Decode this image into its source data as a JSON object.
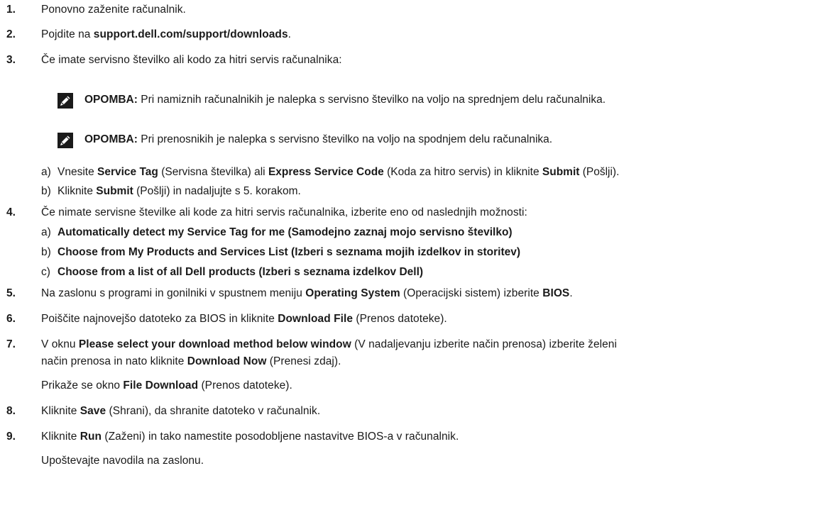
{
  "steps": [
    {
      "num": "1.",
      "parts": [
        {
          "t": "Ponovno zaženite računalnik."
        }
      ]
    },
    {
      "num": "2.",
      "parts": [
        {
          "t": "Pojdite na "
        },
        {
          "t": "support.dell.com/support/downloads",
          "b": true
        },
        {
          "t": "."
        }
      ]
    },
    {
      "num": "3.",
      "parts": [
        {
          "t": "Če imate servisno številko ali kodo za hitri servis računalnika:"
        }
      ]
    },
    {
      "num": "4.",
      "parts": [
        {
          "t": "Če nimate servisne številke ali kode za hitri servis računalnika, izberite eno od naslednjih možnosti:"
        }
      ]
    },
    {
      "num": "5.",
      "parts": [
        {
          "t": "Na zaslonu s programi in gonilniki v spustnem meniju "
        },
        {
          "t": "Operating System",
          "b": true
        },
        {
          "t": " (Operacijski sistem) izberite "
        },
        {
          "t": "BIOS",
          "b": true
        },
        {
          "t": "."
        }
      ]
    },
    {
      "num": "6.",
      "parts": [
        {
          "t": "Poiščite najnovejšo datoteko za BIOS in kliknite "
        },
        {
          "t": "Download File",
          "b": true
        },
        {
          "t": " (Prenos datoteke)."
        }
      ]
    },
    {
      "num": "7.",
      "parts": [
        {
          "t": "V oknu "
        },
        {
          "t": "Please select your download method below window",
          "b": true
        },
        {
          "t": " (V nadaljevanju izberite način prenosa) izberite želeni"
        }
      ]
    },
    {
      "num": "8.",
      "parts": [
        {
          "t": "Kliknite "
        },
        {
          "t": "Save",
          "b": true
        },
        {
          "t": " (Shrani), da shranite datoteko v računalnik."
        }
      ]
    },
    {
      "num": "9.",
      "parts": [
        {
          "t": "Kliknite "
        },
        {
          "t": "Run",
          "b": true
        },
        {
          "t": " (Zaženi) in tako namestite posodobljene nastavitve BIOS-a v računalnik."
        }
      ]
    }
  ],
  "step7_line2": [
    {
      "t": "način prenosa in nato kliknite "
    },
    {
      "t": "Download Now",
      "b": true
    },
    {
      "t": " (Prenesi zdaj)."
    }
  ],
  "step7_result": [
    {
      "t": "Prikaže se okno "
    },
    {
      "t": "File Download",
      "b": true
    },
    {
      "t": " (Prenos datoteke)."
    }
  ],
  "step9_result": [
    {
      "t": "Upoštevajte navodila na zaslonu."
    }
  ],
  "notes": [
    {
      "icon": "pencil-note-icon",
      "label": "OPOMBA:",
      "text": " Pri namiznih računalnikih je nalepka s servisno številko na voljo na sprednjem delu računalnika."
    },
    {
      "icon": "pencil-note-icon",
      "label": "OPOMBA:",
      "text": " Pri prenosnikih je nalepka s servisno številko na voljo na spodnjem delu računalnika."
    }
  ],
  "step3_sub": [
    {
      "label": "a)",
      "parts": [
        {
          "t": "Vnesite "
        },
        {
          "t": "Service Tag",
          "b": true
        },
        {
          "t": " (Servisna številka) ali "
        },
        {
          "t": "Express Service Code",
          "b": true
        },
        {
          "t": " (Koda za hitro servis) in kliknite "
        },
        {
          "t": "Submit",
          "b": true
        },
        {
          "t": " (Pošlji)."
        }
      ]
    },
    {
      "label": "b)",
      "parts": [
        {
          "t": "Kliknite "
        },
        {
          "t": "Submit",
          "b": true
        },
        {
          "t": " (Pošlji) in nadaljujte s 5. korakom."
        }
      ]
    }
  ],
  "step4_sub": [
    {
      "label": "a)",
      "parts": [
        {
          "t": "Automatically detect my Service Tag for me (Samodejno zaznaj mojo servisno številko)",
          "b": true
        }
      ]
    },
    {
      "label": "b)",
      "parts": [
        {
          "t": "Choose from My Products and Services List (Izberi s seznama mojih izdelkov in storitev)",
          "b": true
        }
      ]
    },
    {
      "label": "c)",
      "parts": [
        {
          "t": "Choose from a list of all Dell products (Izberi s seznama izdelkov Dell)",
          "b": true
        }
      ]
    }
  ]
}
